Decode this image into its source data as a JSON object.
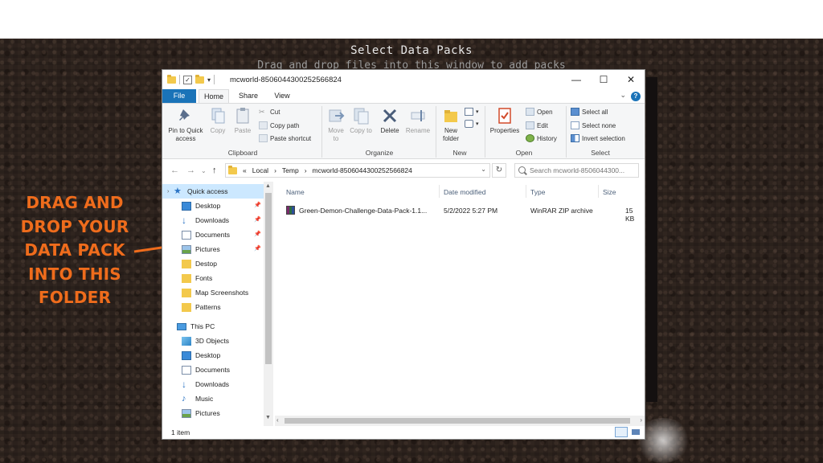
{
  "background": {
    "title": "Select Data Packs",
    "subtitle": "Drag and drop files into this window to add packs"
  },
  "callout": {
    "lines": [
      "DRAG AND",
      "DROP YOUR",
      "DATA PACK",
      "INTO THIS",
      "FOLDER"
    ],
    "color": "#ef6c1c"
  },
  "window": {
    "title": "mcworld-8506044300252566824",
    "controls": {
      "minimize": "—",
      "maximize": "☐",
      "close": "✕"
    },
    "tabs": [
      "File",
      "Home",
      "Share",
      "View"
    ],
    "active_tab": "Home",
    "help_label": "?",
    "ribbon": {
      "clipboard": {
        "label": "Clipboard",
        "pin": "Pin to Quick access",
        "copy": "Copy",
        "paste": "Paste",
        "cut": "Cut",
        "copy_path": "Copy path",
        "paste_shortcut": "Paste shortcut"
      },
      "organize": {
        "label": "Organize",
        "move_to": "Move to",
        "copy_to": "Copy to",
        "delete": "Delete",
        "rename": "Rename"
      },
      "new": {
        "label": "New",
        "new_folder": "New folder"
      },
      "open": {
        "label": "Open",
        "properties": "Properties",
        "open": "Open",
        "edit": "Edit",
        "history": "History"
      },
      "select": {
        "label": "Select",
        "select_all": "Select all",
        "select_none": "Select none",
        "invert": "Invert selection"
      }
    },
    "address": {
      "crumbs": [
        "«",
        "Local",
        "›",
        "Temp",
        "›",
        "mcworld-8506044300252566824"
      ],
      "search_placeholder": "Search mcworld-8506044300..."
    },
    "nav": {
      "quick_access": "Quick access",
      "quick_items": [
        "Desktop",
        "Downloads",
        "Documents",
        "Pictures",
        "Destop",
        "Fonts",
        "Map Screenshots",
        "Patterns"
      ],
      "this_pc": "This PC",
      "pc_items": [
        "3D Objects",
        "Desktop",
        "Documents",
        "Downloads",
        "Music",
        "Pictures"
      ]
    },
    "columns": [
      "Name",
      "Date modified",
      "Type",
      "Size"
    ],
    "files": [
      {
        "name": "Green-Demon-Challenge-Data-Pack-1.1...",
        "date": "5/2/2022 5:27 PM",
        "type": "WinRAR ZIP archive",
        "size": "15 KB"
      }
    ],
    "status": "1 item"
  }
}
